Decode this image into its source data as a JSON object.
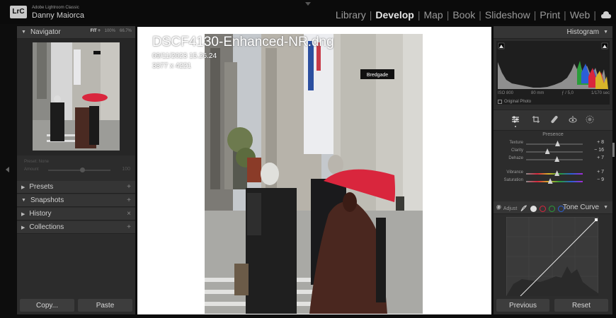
{
  "app": {
    "logo": "LrC",
    "product": "Adobe Lightroom Classic",
    "user": "Danny Maiorca"
  },
  "modules": [
    {
      "label": "Library",
      "active": false
    },
    {
      "label": "Develop",
      "active": true
    },
    {
      "label": "Map",
      "active": false
    },
    {
      "label": "Book",
      "active": false
    },
    {
      "label": "Slideshow",
      "active": false
    },
    {
      "label": "Print",
      "active": false
    },
    {
      "label": "Web",
      "active": false
    }
  ],
  "navigator": {
    "title": "Navigator",
    "zoom_options": [
      "FIT ÷",
      "100%",
      "66.7%"
    ],
    "zoom_selected": 0
  },
  "preset_amount": {
    "label1": "Preset: None",
    "label2": "Amount",
    "value": "100",
    "level_percent": 55
  },
  "left_panels": [
    {
      "label": "Presets",
      "expanded": false,
      "action": "+"
    },
    {
      "label": "Snapshots",
      "expanded": true,
      "action": "+"
    },
    {
      "label": "History",
      "expanded": false,
      "action": "×"
    },
    {
      "label": "Collections",
      "expanded": false,
      "action": "+"
    }
  ],
  "left_buttons": {
    "copy": "Copy...",
    "paste": "Paste"
  },
  "photo": {
    "filename": "DSCF4130-Enhanced-NR.dng",
    "datetime": "09/11/2023 15.26.24",
    "dimensions": "3377 x 4221",
    "sign_text": "Bredgade"
  },
  "histogram": {
    "title": "Histogram",
    "iso": "ISO 800",
    "focal": "80 mm",
    "aperture": "ƒ / 5,0",
    "shutter": "1/170 sec",
    "original_photo": "Original Photo"
  },
  "presence": {
    "title": "Presence",
    "sliders": [
      {
        "label": "Texture",
        "value": "+ 8",
        "pos": 0.55
      },
      {
        "label": "Clarity",
        "value": "− 16",
        "pos": 0.37
      },
      {
        "label": "Dehaze",
        "value": "+ 7",
        "pos": 0.54
      },
      {
        "label": "Vibrance",
        "value": "+ 7",
        "pos": 0.54
      },
      {
        "label": "Saturation",
        "value": "− 9",
        "pos": 0.42
      }
    ]
  },
  "tone_curve": {
    "title": "Tone Curve",
    "adjust_label": "Adjust"
  },
  "right_buttons": {
    "previous": "Previous",
    "reset": "Reset"
  },
  "colors": {
    "panel": "#2c2c2c",
    "accent_red": "#d9263d",
    "accent_green": "#2a9d3a",
    "accent_blue": "#2b5fd6"
  }
}
